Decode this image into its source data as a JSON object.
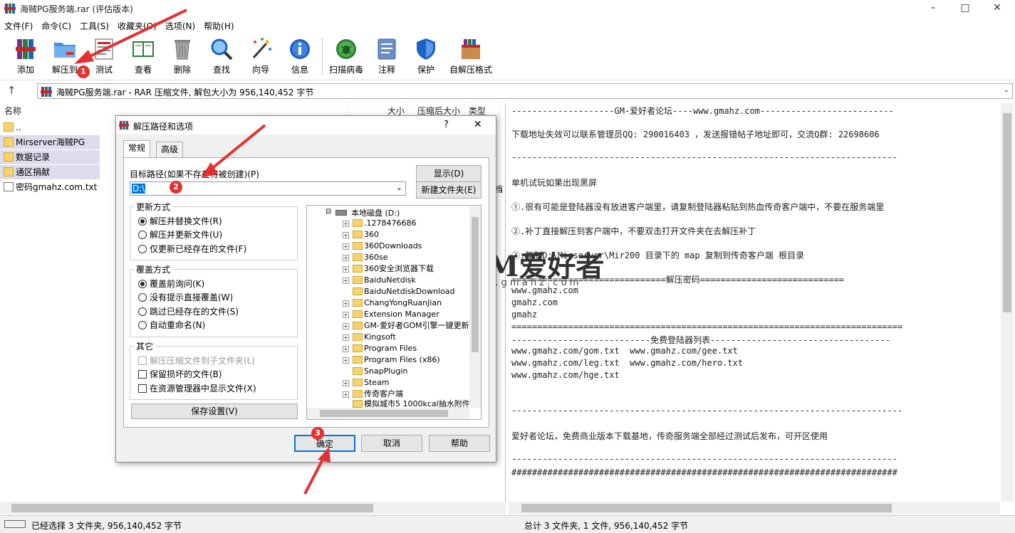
{
  "window": {
    "title": "海贼PG服务端.rar (评估版本)"
  },
  "menu": [
    "文件(F)",
    "命令(C)",
    "工具(S)",
    "收藏夹(O)",
    "选项(N)",
    "帮助(H)"
  ],
  "toolbar": [
    {
      "label": "添加",
      "icon": "add-archive-icon"
    },
    {
      "label": "解压到",
      "icon": "extract-to-icon"
    },
    {
      "label": "测试",
      "icon": "test-icon"
    },
    {
      "label": "查看",
      "icon": "view-book-icon"
    },
    {
      "label": "删除",
      "icon": "trash-icon"
    },
    {
      "label": "查找",
      "icon": "magnifier-icon"
    },
    {
      "label": "向导",
      "icon": "wizard-wand-icon"
    },
    {
      "label": "信息",
      "icon": "info-icon"
    },
    {
      "label": "扫描病毒",
      "icon": "virus-scan-icon"
    },
    {
      "label": "注释",
      "icon": "comment-icon"
    },
    {
      "label": "保护",
      "icon": "shield-icon"
    },
    {
      "label": "自解压格式",
      "icon": "sfx-icon"
    }
  ],
  "address": {
    "text": "海贼PG服务端.rar - RAR 压缩文件, 解包大小为 956,140,452 字节"
  },
  "filelist": {
    "headers": [
      "名称",
      "大小",
      "压缩后大小",
      "类型"
    ],
    "rows": [
      {
        "name": ".."
      },
      {
        "name": "Mirserver海贼PG"
      },
      {
        "name": "数据记录"
      },
      {
        "name": "通区捐献"
      },
      {
        "name": "密码gmahz.com.txt"
      }
    ],
    "partial_type": "档"
  },
  "comment": [
    "--------------------GM-爱好者论坛----www.gmahz.com--------------------------",
    "下载地址失效可以联系管理员QQ: 290016403 ，发送报错帖子地址即可，交流Q群: 22698606",
    "---------------------------------------------------------------------------",
    "单机试玩如果出现黑屏",
    "①.很有可能是登陆器没有放进客户端里，请复制登陆器粘贴到热血传奇客户端中，不要在服务端里",
    "②.补丁直接解压到客户端中，不要双击打开文件夹在去解压补丁",
    "③.复制D:\\Mirserver\\Mir200 目录下的 map 复制到传奇客户端 根目录",
    "==============================解压密码============================",
    "www.gmahz.com",
    "gmahz.com",
    "gmahz",
    "============================================================================",
    "---------------------------免费登陆器列表-----------------------------------",
    "www.gmahz.com/gom.txt  www.gmahz.com/gee.txt",
    "www.gmahz.com/leg.txt  www.gmahz.com/hero.txt",
    "www.gmahz.com/hge.txt",
    "----------------------------------------------------------------------------",
    "爱好者论坛，免费商业版本下载基地，传奇服务端全部经过测试后发布，可开区使用",
    "---------------------------------------------------------------------------",
    "###########################################################################"
  ],
  "status": {
    "left": "已经选择 3 文件夹, 956,140,452 字节",
    "right": "总计 3 文件夹, 1 文件, 956,140,452 字节"
  },
  "dialog": {
    "title": "解压路径和选项",
    "help_mark": "?",
    "tabs": [
      "常规",
      "高级"
    ],
    "path_label": "目标路径(如果不存在将被创建)(P)",
    "path_value": "D:\\",
    "btn_show": "显示(D)",
    "btn_newfolder": "新建文件夹(E)",
    "update_group": "更新方式",
    "update_opts": [
      "解压并替换文件(R)",
      "解压并更新文件(U)",
      "仅更新已经存在的文件(F)"
    ],
    "overwrite_group": "覆盖方式",
    "overwrite_opts": [
      "覆盖前询问(K)",
      "没有提示直接覆盖(W)",
      "跳过已经存在的文件(S)",
      "自动重命名(N)"
    ],
    "misc_group": "其它",
    "misc_opts": [
      "解压压缩文件到子文件夹(L)",
      "保留损坏的文件(B)",
      "在资源管理器中显示文件(X)"
    ],
    "btn_save": "保存设置(V)",
    "tree_root": "本地磁盘 (D:)",
    "tree": [
      ".1278476686",
      "360",
      "360Downloads",
      "360se",
      "360安全浏览器下载",
      "BaiduNetdisk",
      "BaiduNetdiskDownload",
      "ChangYongRuanJian",
      "Extension Manager",
      "GM-爱好者GOM引擎一键更新",
      "Kingsoft",
      "Program Files",
      "Program Files (x86)",
      "SnapPlugin",
      "Steam",
      "传奇客户端",
      "模拟城市5 1000kcal抽水附件"
    ],
    "btn_ok": "确定",
    "btn_cancel": "取消",
    "btn_help": "帮助"
  },
  "watermark": {
    "brand": "GM爱好者",
    "url": "w w w . g m a h z . c o m"
  },
  "badges": [
    "1",
    "2",
    "3"
  ],
  "colors": {
    "accent": "#0078d7",
    "annotation": "#e53030"
  }
}
